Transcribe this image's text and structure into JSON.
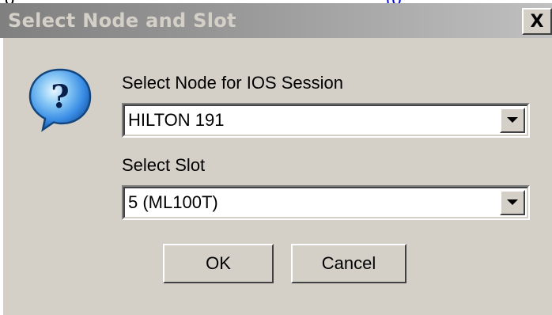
{
  "dialog": {
    "title": "Select Node and Slot",
    "close_label": "X"
  },
  "node": {
    "label": "Select Node for IOS Session",
    "value": "HILTON 191"
  },
  "slot": {
    "label": "Select Slot",
    "value": "5 (ML100T)"
  },
  "buttons": {
    "ok": "OK",
    "cancel": "Cancel"
  },
  "icons": {
    "question": "question-icon",
    "dropdown": "chevron-down-icon"
  },
  "colors": {
    "dialog_bg": "#d4d0c8",
    "titlebar_start": "#808080",
    "titlebar_end": "#c0c0c0",
    "icon_blue": "#3a8ee6"
  }
}
